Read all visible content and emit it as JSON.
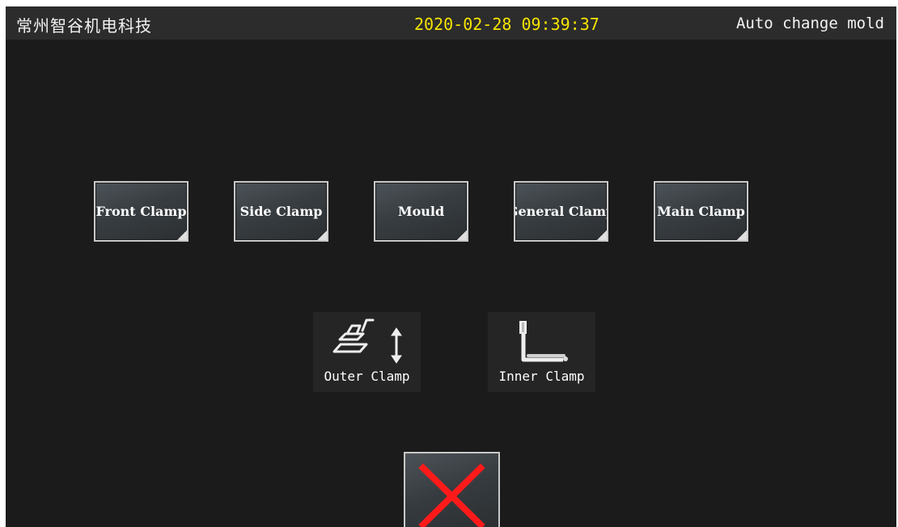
{
  "header": {
    "brand": "常州智谷机电科技",
    "datetime": "2020-02-28 09:39:37",
    "mode": "Auto change mold"
  },
  "clamp_buttons": [
    {
      "label": "Front Clamp"
    },
    {
      "label": "Side Clamp"
    },
    {
      "label": "Mould"
    },
    {
      "label": "General Clamp"
    },
    {
      "label": "Main Clamp"
    }
  ],
  "icon_buttons": [
    {
      "label": "Outer Clamp",
      "icon": "outer-clamp-icon"
    },
    {
      "label": "Inner Clamp",
      "icon": "inner-clamp-icon"
    }
  ],
  "close_button": {
    "icon": "close-x-icon",
    "color": "#ff1a1a"
  },
  "colors": {
    "background": "#1b1b1b",
    "header_bar": "#2c2c2c",
    "datetime": "#f6e400",
    "button_border": "#c9c9c9"
  }
}
